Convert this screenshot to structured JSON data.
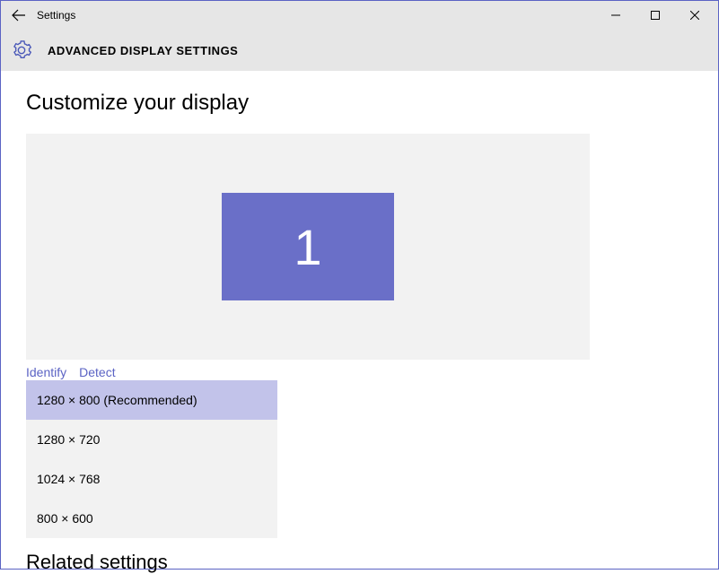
{
  "titlebar": {
    "title": "Settings"
  },
  "header": {
    "title": "ADVANCED DISPLAY SETTINGS"
  },
  "content": {
    "customize_heading": "Customize your display",
    "monitor_number": "1",
    "identify_label": "Identify",
    "detect_label": "Detect",
    "resolutions": [
      {
        "label": "1280 × 800 (Recommended)",
        "selected": true
      },
      {
        "label": "1280 × 720",
        "selected": false
      },
      {
        "label": "1024 × 768",
        "selected": false
      },
      {
        "label": "800 × 600",
        "selected": false
      }
    ],
    "related_heading": "Related settings"
  }
}
